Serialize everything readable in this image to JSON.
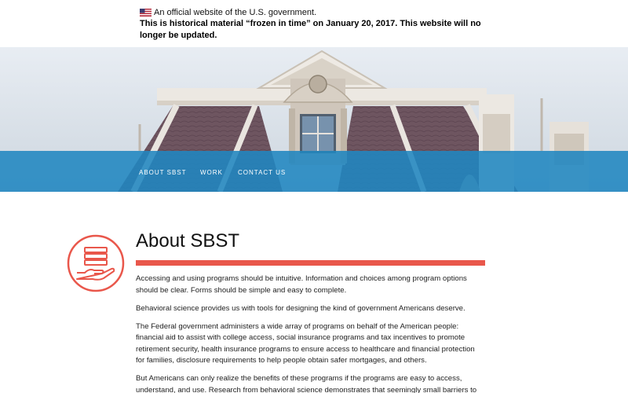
{
  "gov_banner": {
    "official_text": "An official website of the U.S. government.",
    "frozen_notice": "This is historical material “frozen in time” on January 20, 2017. This website will no longer be updated."
  },
  "nav": {
    "items": [
      {
        "label": "ABOUT SBST"
      },
      {
        "label": "WORK"
      },
      {
        "label": "CONTACT US"
      }
    ]
  },
  "main": {
    "title": "About SBST",
    "paragraphs": [
      "Accessing and using programs should be intuitive. Information and choices among program options should be clear. Forms should be simple and easy to complete.",
      "Behavioral science provides us with tools for designing the kind of government Americans deserve.",
      "The Federal government administers a wide array of programs on behalf of the American people: financial aid to assist with college access, social insurance programs and tax incentives to promote retirement security, health insurance programs to ensure access to healthcare and financial protection for families, disclosure requirements to help people obtain safer mortgages, and others.",
      "But Americans can only realize the benefits of these programs if the programs are easy to access, understand, and use. Research from behavioral science demonstrates that seemingly small barriers to"
    ]
  },
  "colors": {
    "nav_bar": "#2086c0",
    "accent_red": "#e9574b",
    "text": "#1e1e1e"
  },
  "icons": {
    "flag": "us-flag-icon",
    "about": "hand-holding-stack-icon"
  }
}
